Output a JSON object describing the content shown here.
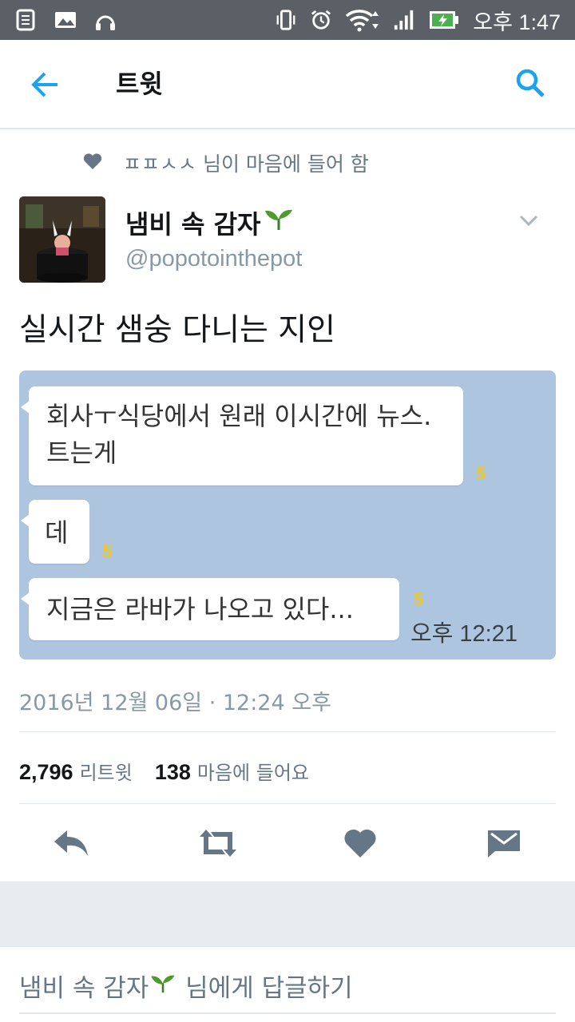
{
  "statusbar": {
    "time": "오후 1:47",
    "icons": [
      "notes-icon",
      "image-icon",
      "headset-icon",
      "vibrate-icon",
      "alarm-icon",
      "wifi-icon",
      "signal-icon",
      "battery-charging-icon"
    ]
  },
  "toolbar": {
    "title": "트윗",
    "back_icon": "back-arrow-icon",
    "search_icon": "search-icon"
  },
  "social_context": {
    "icon": "heart-icon",
    "text": "ㅍㅍㅅㅅ 님이 마음에 들어 함"
  },
  "tweet": {
    "author_name": "냄비 속 감자",
    "author_emoji": "seedling-icon",
    "handle": "@popotointhepot",
    "text": "실시간 샘숭 다니는 지인",
    "timestamp": "2016년 12월 06일 · 12:24 오후"
  },
  "media": {
    "messages": [
      "회사ㅜ식당에서 원래 이시간에 뉴스.트는게",
      "데",
      "지금은 라바가 나오고 있다..."
    ],
    "read_mark": "5",
    "message_time": "오후 12:21"
  },
  "stats": {
    "retweets_count": "2,796",
    "retweets_label": "리트윗",
    "likes_count": "138",
    "likes_label": "마음에 들어요"
  },
  "actions": [
    "reply-icon",
    "retweet-icon",
    "like-icon",
    "direct-message-icon"
  ],
  "reply": {
    "name": "냄비 속 감자",
    "suffix": " 님에게 답글하기"
  },
  "colors": {
    "accent": "#1da1f2",
    "statusbar": "#5a6066",
    "media_bg": "#adc5df",
    "gray_text": "#657786"
  }
}
